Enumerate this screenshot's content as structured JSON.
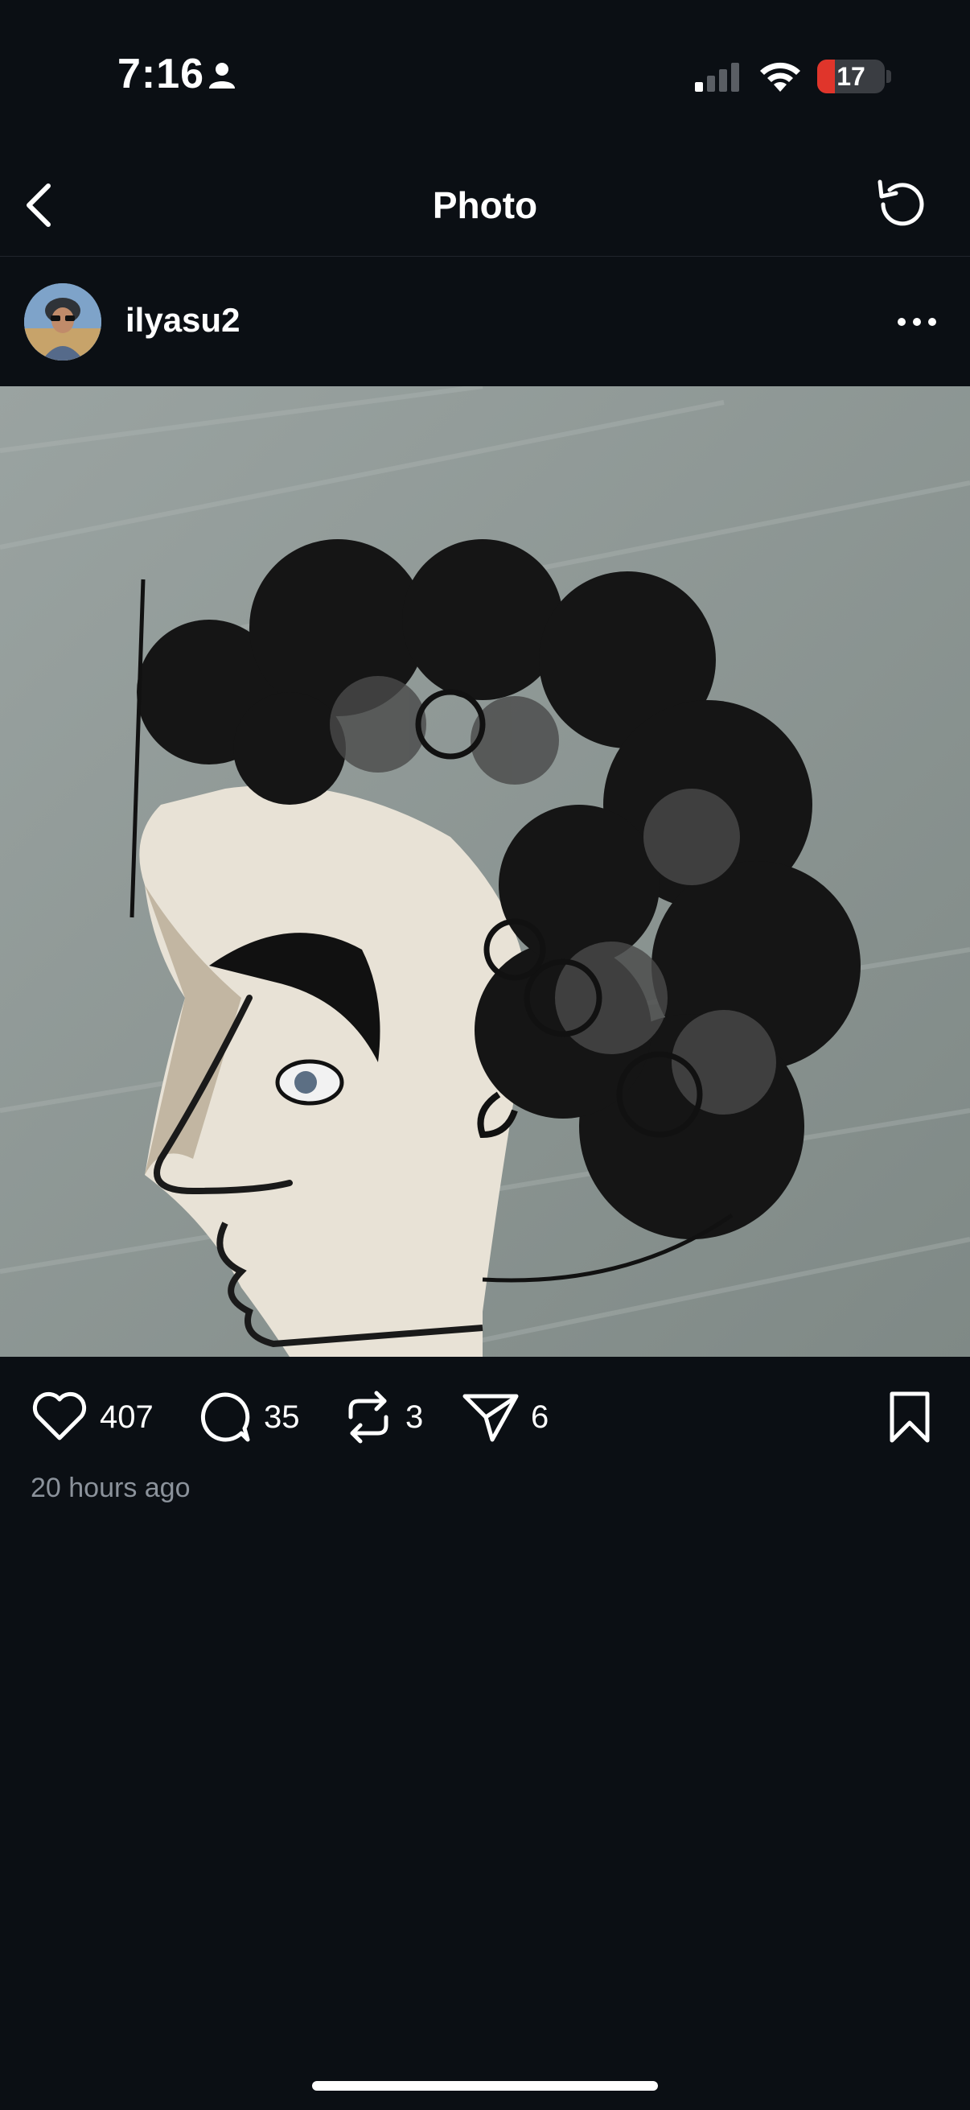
{
  "status_bar": {
    "time": "7:16",
    "battery_level": "17",
    "battery_color": "#e0352b",
    "icons": [
      "person-icon",
      "signal-icon",
      "wifi-icon",
      "battery-icon"
    ]
  },
  "nav": {
    "title": "Photo",
    "back_icon": "chevron-left-icon",
    "refresh_icon": "refresh-icon"
  },
  "post": {
    "author": "ilyasu2",
    "more_icon": "ellipsis-icon",
    "image_description_icon": "caricature-artwork",
    "actions": {
      "likes": "407",
      "comments": "35",
      "reposts": "3",
      "shares": "6"
    },
    "timestamp": "20 hours ago"
  },
  "colors": {
    "background": "#0b0f14",
    "text": "#ffffff",
    "muted_text": "#8b929b"
  }
}
